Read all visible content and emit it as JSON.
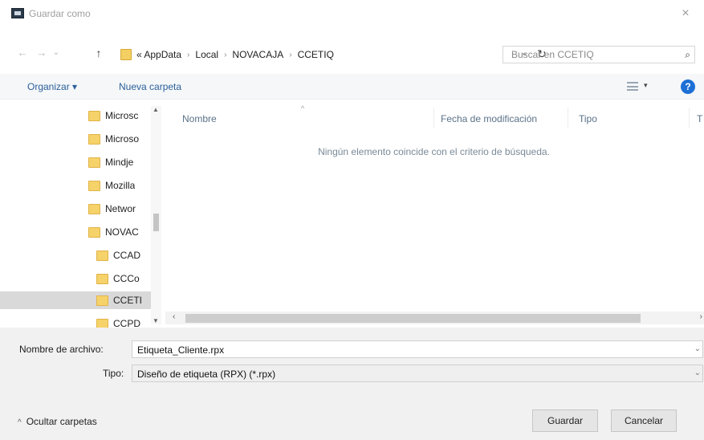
{
  "window": {
    "title": "Guardar como",
    "close": "×"
  },
  "nav": {
    "back": "←",
    "forward": "→",
    "recent": "⌄",
    "up": "↑",
    "path": [
      "« AppData",
      "Local",
      "NOVACAJA",
      "CCETIQ"
    ],
    "separator": "›",
    "dropdown": "⌄",
    "refresh": "↻",
    "search_placeholder": "Buscar en CCETIQ",
    "search_glyph": "⌕"
  },
  "toolbar": {
    "organize": "Organizar ▾",
    "new_folder": "Nueva carpeta",
    "view_arrow": "▾",
    "help": "?"
  },
  "tree": {
    "items": [
      "Microsc",
      "Microso",
      "Mindje",
      "Mozilla",
      "Networ",
      "NOVAC",
      "CCAD",
      "CCCo",
      "CCETI",
      "CCPD"
    ],
    "selected": "CCETI",
    "scroll_up": "▲",
    "scroll_down": "▼"
  },
  "columns": {
    "name": "Nombre",
    "sort": "^",
    "date": "Fecha de modificación",
    "type": "Tipo",
    "size": "T"
  },
  "empty_message": "Ningún elemento coincide con el criterio de búsqueda.",
  "hscroll": {
    "left": "‹",
    "right": "›"
  },
  "form": {
    "filename_label": "Nombre de archivo:",
    "filename_value": "Etiqueta_Cliente.rpx",
    "type_label": "Tipo:",
    "type_value": "Diseño de etiqueta (RPX) (*.rpx)",
    "arrow": "⌄"
  },
  "footer": {
    "toggle": "Ocultar carpetas",
    "toggle_chev": "^",
    "save": "Guardar",
    "cancel": "Cancelar"
  },
  "colors": {
    "link": "#2b5f9a",
    "folder": "#f6d26a",
    "help": "#1d6fd6",
    "selected": "#d9d9d9"
  }
}
